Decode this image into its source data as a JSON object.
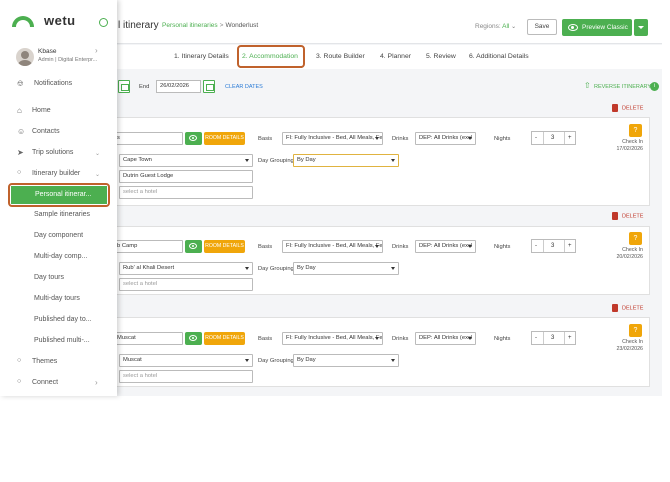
{
  "sidebar": {
    "logo_text": "wetu",
    "user": {
      "name": "Kbase",
      "role": "Admin | Digital Enterpr..."
    },
    "items": [
      {
        "label": "Notifications"
      },
      {
        "label": "Home"
      },
      {
        "label": "Contacts"
      },
      {
        "label": "Trip solutions"
      },
      {
        "label": "Itinerary builder"
      }
    ],
    "sub_items": [
      {
        "label": "Personal itinerar..."
      },
      {
        "label": "Sample itineraries"
      },
      {
        "label": "Day component"
      },
      {
        "label": "Multi-day comp..."
      },
      {
        "label": "Day tours"
      },
      {
        "label": "Multi-day tours"
      },
      {
        "label": "Published day to..."
      },
      {
        "label": "Published multi-..."
      }
    ],
    "bottom_items": [
      {
        "label": "Themes"
      },
      {
        "label": "Connect"
      }
    ]
  },
  "header": {
    "title": "l itinerary",
    "breadcrumb": [
      "Personal itineraries",
      "Wonderlust"
    ],
    "breadcrumb_sep": ">",
    "regions_label": "Regions:",
    "regions_value": "All",
    "save_label": "Save",
    "preview_label": "Preview Classic"
  },
  "tabs": [
    {
      "label": "1. Itinerary Details"
    },
    {
      "label": "2. Accommodation"
    },
    {
      "label": "3. Route Builder"
    },
    {
      "label": "4. Planner"
    },
    {
      "label": "5. Review"
    },
    {
      "label": "6. Additional Details"
    }
  ],
  "dates": {
    "end_label": "End",
    "end_value": "26/02/2026",
    "clear_label": "CLEAR DATES",
    "reverse_label": "REVERSE ITINERARY",
    "info": "i"
  },
  "labels": {
    "room_details": "ROOM DETAILS",
    "basis": "Basis",
    "drinks": "Drinks",
    "nights": "Nights",
    "day_grouping": "Day Grouping",
    "delete": "DELETE",
    "check_in": "Check In",
    "question": "?",
    "minus": "-",
    "plus": "+"
  },
  "stops": [
    {
      "name": "s",
      "basis": "FI: Fully Inclusive - Bed, All Meals, Fees",
      "drinks": "DEP: All Drinks (excl",
      "nights": "3",
      "location": "Cape Town",
      "accommodation": "Dutrin Guest Lodge",
      "day_grouping": "By Day",
      "hotel_placeholder": "select a hotel",
      "check_in_date": "17/02/2026"
    },
    {
      "name": "b Camp",
      "basis": "FI: Fully Inclusive - Bed, All Meals, Fees",
      "drinks": "DEP: All Drinks (excl",
      "nights": "3",
      "location": "Rub' al Khali Desert",
      "accommodation": "",
      "day_grouping": "By Day",
      "hotel_placeholder": "select a hotel",
      "check_in_date": "20/02/2026"
    },
    {
      "name": "Muscat",
      "basis": "FI: Fully Inclusive - Bed, All Meals, Fees",
      "drinks": "DEP: All Drinks (excl",
      "nights": "3",
      "location": "Muscat",
      "accommodation": "",
      "day_grouping": "By Day",
      "hotel_placeholder": "select a hotel",
      "check_in_date": "23/02/2026"
    }
  ],
  "colors": {
    "brand_green": "#4caf50",
    "highlight_orange": "#c0622c",
    "room_button": "#f0a60a",
    "delete_red": "#c0392b",
    "link_blue": "#2a7bd6"
  }
}
